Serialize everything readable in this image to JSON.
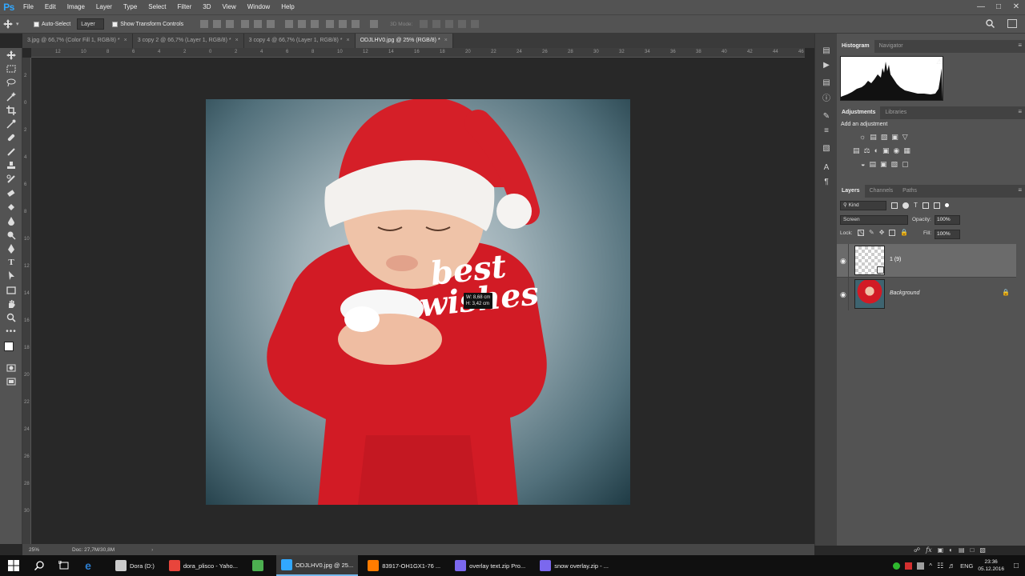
{
  "app": {
    "logo": "Ps"
  },
  "menu": [
    "File",
    "Edit",
    "Image",
    "Layer",
    "Type",
    "Select",
    "Filter",
    "3D",
    "View",
    "Window",
    "Help"
  ],
  "options": {
    "auto_select_label": "Auto-Select",
    "auto_select_target": "Layer",
    "transform_label": "Show Transform Controls",
    "mode_3d": "3D Mode:"
  },
  "tabs": [
    {
      "label": "3.jpg @ 66,7% (Color Fill 1, RGB/8) *",
      "active": false
    },
    {
      "label": "3 copy 2 @ 66,7% (Layer 1, RGB/8) *",
      "active": false
    },
    {
      "label": "3 copy 4 @ 66,7% (Layer 1, RGB/8) *",
      "active": false
    },
    {
      "label": "ODJLHV0.jpg @ 25% (RGB/8) *",
      "active": true
    }
  ],
  "ruler_h": [
    "12",
    "10",
    "8",
    "6",
    "4",
    "2",
    "0",
    "2",
    "4",
    "6",
    "8",
    "10",
    "12",
    "14",
    "16",
    "18",
    "20",
    "22",
    "24",
    "26",
    "28",
    "30",
    "32",
    "34",
    "36",
    "38",
    "40",
    "42",
    "44",
    "46"
  ],
  "ruler_v": [
    "2",
    "0",
    "2",
    "4",
    "6",
    "8",
    "10",
    "12",
    "14",
    "16",
    "18",
    "20",
    "22",
    "24",
    "26",
    "28",
    "30"
  ],
  "canvas": {
    "overlay_line1": "best",
    "overlay_line2": "wishes",
    "tooltip_w": "W: 8,68 cm",
    "tooltip_h": "H: 3,42 cm"
  },
  "histogram": {
    "tabs": [
      "Histogram",
      "Navigator"
    ]
  },
  "adjustments": {
    "tabs": [
      "Adjustments",
      "Libraries"
    ],
    "title": "Add an adjustment"
  },
  "layers": {
    "tabs": [
      "Layers",
      "Channels",
      "Paths"
    ],
    "filter_kind": "Kind",
    "blend_mode": "Screen",
    "opacity_label": "Opacity:",
    "opacity": "100%",
    "lock_label": "Lock:",
    "fill_label": "Fill:",
    "fill": "100%",
    "items": [
      {
        "name": "1 (9)",
        "selected": true,
        "visible": true
      },
      {
        "name": "Background",
        "selected": false,
        "visible": true,
        "locked": true
      }
    ]
  },
  "status": {
    "zoom": "25%",
    "doc": "Doc: 27,7M/30,8M"
  },
  "taskbar": {
    "apps": [
      {
        "label": "Dora (D:)",
        "color": "#cccccc"
      },
      {
        "label": "dora_plisco - Yaho...",
        "color": "#e8453c"
      },
      {
        "label": "",
        "color": "#4caf50"
      },
      {
        "label": "ODJLHV0.jpg @ 25...",
        "color": "#31a8ff",
        "active": true
      },
      {
        "label": "83917-OH1GX1-76 ...",
        "color": "#ff7c00"
      },
      {
        "label": "overlay text.zip Pro...",
        "color": "#7b68ee"
      },
      {
        "label": "snow overlay.zip - ...",
        "color": "#7b68ee"
      }
    ],
    "lang": "ENG",
    "time": "23:36",
    "date": "05.12.2016"
  }
}
